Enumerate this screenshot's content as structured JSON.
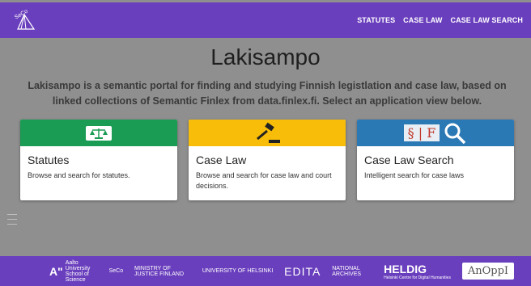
{
  "header": {
    "logo_text": "SeCo",
    "nav": [
      {
        "label": "STATUTES"
      },
      {
        "label": "CASE LAW"
      },
      {
        "label": "CASE LAW SEARCH"
      }
    ]
  },
  "main": {
    "title": "Lakisampo",
    "description": "Lakisampo is a semantic portal for finding and studying Finnish legistlation and case law, based on linked collections of Semantic Finlex from data.finlex.fi. Select an application view below."
  },
  "cards": [
    {
      "title": "Statutes",
      "description": "Browse and search for statutes.",
      "color": "#1a9c55",
      "icon": "scales-icon"
    },
    {
      "title": "Case Law",
      "description": "Browse and search for case law and court decisions.",
      "color": "#f8bd09",
      "icon": "gavel-icon"
    },
    {
      "title": "Case Law Search",
      "description": "Intelligent search for case laws",
      "color": "#2a78b4",
      "icon": "magnifier-icon",
      "media_text": "§ | F"
    }
  ],
  "footer": {
    "logos": [
      {
        "big": "A\"",
        "small": "Aalto University School of Science"
      },
      {
        "big": "",
        "small": "SeCo"
      },
      {
        "big": "",
        "small": "MINISTRY OF JUSTICE FINLAND"
      },
      {
        "big": "",
        "small": "UNIVERSITY OF HELSINKI"
      },
      {
        "big": "EDITA",
        "small": ""
      },
      {
        "big": "",
        "small": "NATIONAL ARCHIVES"
      },
      {
        "big": "HELDIG",
        "small": "Helsinki Centre for Digital Humanities"
      }
    ],
    "anoppi": "AnOppI"
  },
  "colors": {
    "header_bg": "#6a3fbd",
    "page_bg": "#8f8f8f"
  }
}
